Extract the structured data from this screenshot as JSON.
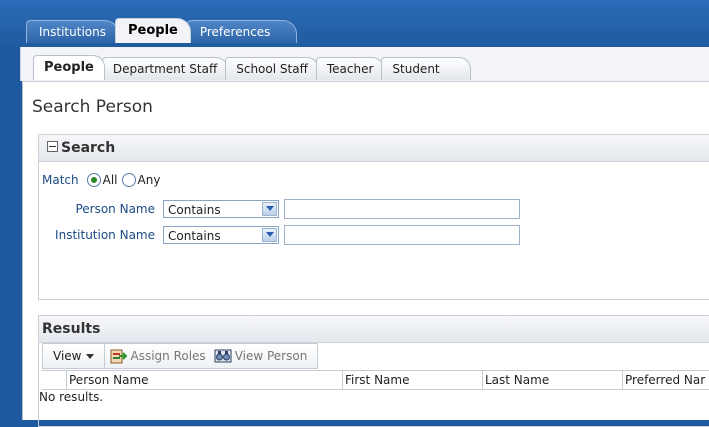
{
  "top_tabs": [
    {
      "label": "Institutions"
    },
    {
      "label": "People"
    },
    {
      "label": "Preferences"
    }
  ],
  "sub_tabs": [
    {
      "label": "People"
    },
    {
      "label": "Department Staff"
    },
    {
      "label": "School Staff"
    },
    {
      "label": "Teacher"
    },
    {
      "label": "Student"
    }
  ],
  "page_title": "Search Person",
  "search": {
    "header": "Search",
    "match_label": "Match",
    "match_options": [
      "All",
      "Any"
    ],
    "match_selected": "All",
    "fields": [
      {
        "label": "Person Name",
        "operator": "Contains",
        "value": ""
      },
      {
        "label": "Institution Name",
        "operator": "Contains",
        "value": ""
      }
    ]
  },
  "results": {
    "header": "Results",
    "toolbar": {
      "view_label": "View",
      "assign_roles_label": "Assign Roles",
      "view_person_label": "View Person"
    },
    "columns": [
      "Person Name",
      "First Name",
      "Last Name",
      "Preferred Nar"
    ],
    "empty_message": "No results."
  },
  "colors": {
    "brand_blue": "#1f5aa0",
    "label_blue": "#1c4b86"
  }
}
